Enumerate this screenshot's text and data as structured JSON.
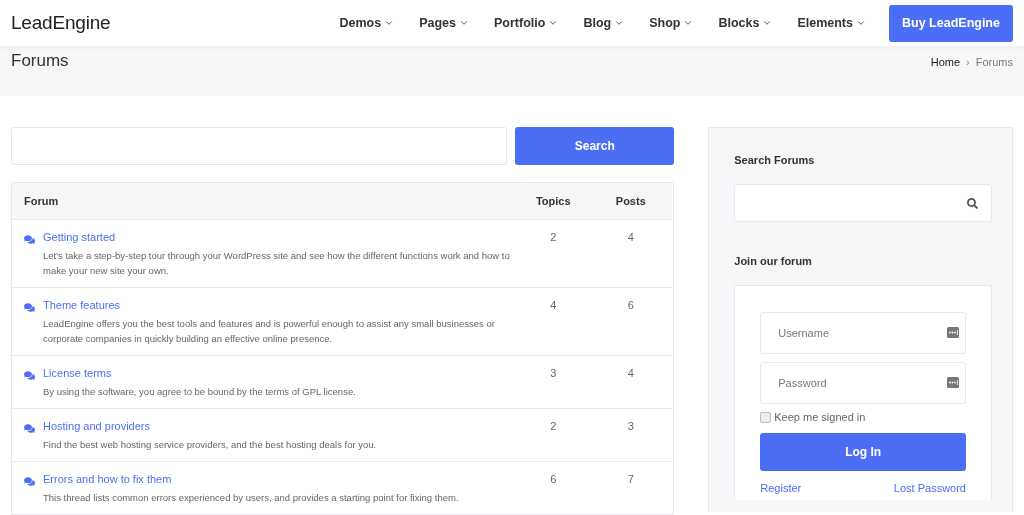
{
  "header": {
    "logo": "LeadEngine",
    "nav": [
      "Demos",
      "Pages",
      "Portfolio",
      "Blog",
      "Shop",
      "Blocks",
      "Elements"
    ],
    "cta": "Buy LeadEngine"
  },
  "title_bar": {
    "title": "Forums",
    "breadcrumb": [
      "Home",
      "Forums"
    ],
    "separator": "›"
  },
  "search": {
    "button": "Search"
  },
  "table": {
    "columns": [
      "Forum",
      "Topics",
      "Posts"
    ],
    "rows": [
      {
        "title": "Getting started",
        "description": "Let's take a step-by-step tour through your WordPress site and see how the different functions work and how to make your new site your own.",
        "topics": "2",
        "posts": "4"
      },
      {
        "title": "Theme features",
        "description": "LeadEngine offers you the best tools and features and is powerful enough to assist any small businesses or corporate companies in quickly building an effective online presence.",
        "topics": "4",
        "posts": "6"
      },
      {
        "title": "License terms",
        "description": "By using the software, you agree to be bound by the terms of GPL license.",
        "topics": "3",
        "posts": "4"
      },
      {
        "title": "Hosting and providers",
        "description": "Find the best web hosting service providers, and the best hosting deals for you.",
        "topics": "2",
        "posts": "3"
      },
      {
        "title": "Errors and how to fix them",
        "description": "This thread lists common errors experienced by users, and provides a starting point for fixing them.",
        "topics": "6",
        "posts": "7"
      }
    ]
  },
  "sidebar": {
    "search_title": "Search Forums",
    "join_title": "Join our forum",
    "username_placeholder": "Username",
    "password_placeholder": "Password",
    "remember": {
      "label": "Keep me signed in",
      "checked": false
    },
    "login_button": "Log In",
    "links": [
      "Register",
      "Lost Password"
    ]
  }
}
